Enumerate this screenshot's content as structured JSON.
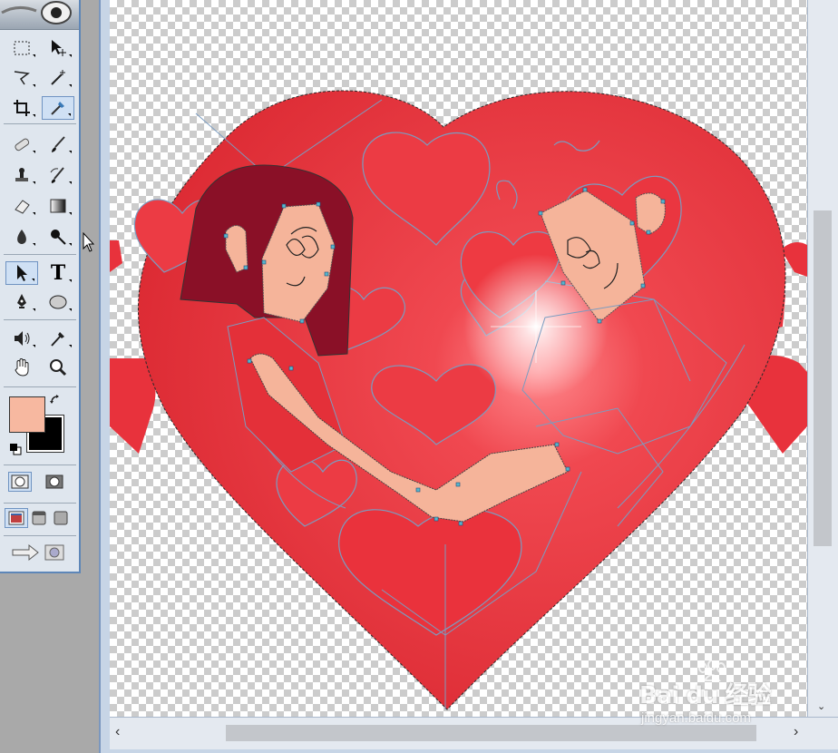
{
  "colors": {
    "foreground": "#f7b8a0",
    "background": "#000000",
    "heart_main": "#e8323c",
    "hair": "#8a1027",
    "skin": "#f5b49a",
    "path_outline": "#7b9cc0"
  },
  "toolbox": {
    "tools": [
      {
        "name": "rect-marquee-icon"
      },
      {
        "name": "move-icon"
      },
      {
        "name": "lasso-icon"
      },
      {
        "name": "magic-wand-icon"
      },
      {
        "name": "crop-icon"
      },
      {
        "name": "eyedropper-slice-icon",
        "selected": true
      },
      {
        "name": "healing-brush-icon"
      },
      {
        "name": "brush-icon"
      },
      {
        "name": "clone-stamp-icon"
      },
      {
        "name": "history-brush-icon"
      },
      {
        "name": "eraser-icon"
      },
      {
        "name": "gradient-icon"
      },
      {
        "name": "blur-icon"
      },
      {
        "name": "dodge-icon"
      },
      {
        "name": "path-selection-icon",
        "selected": true
      },
      {
        "name": "type-icon"
      },
      {
        "name": "pen-icon"
      },
      {
        "name": "ellipse-shape-icon"
      },
      {
        "name": "notes-icon"
      },
      {
        "name": "eyedropper-icon"
      },
      {
        "name": "hand-icon"
      },
      {
        "name": "zoom-icon"
      }
    ],
    "type_tool_glyph": "T",
    "modes": [
      "standard-mode-icon",
      "quick-mask-mode-icon"
    ],
    "screen_modes": [
      "standard-screen-icon",
      "full-screen-menu-icon",
      "full-screen-icon"
    ],
    "jump_to": "jump-to-imageready-icon"
  },
  "watermark": {
    "logo": "Bai du 经验",
    "url": "jingyan.baidu.com"
  },
  "scrollbars": {
    "left_arrow": "‹",
    "right_arrow": "›",
    "down_arrow": "⌄"
  }
}
